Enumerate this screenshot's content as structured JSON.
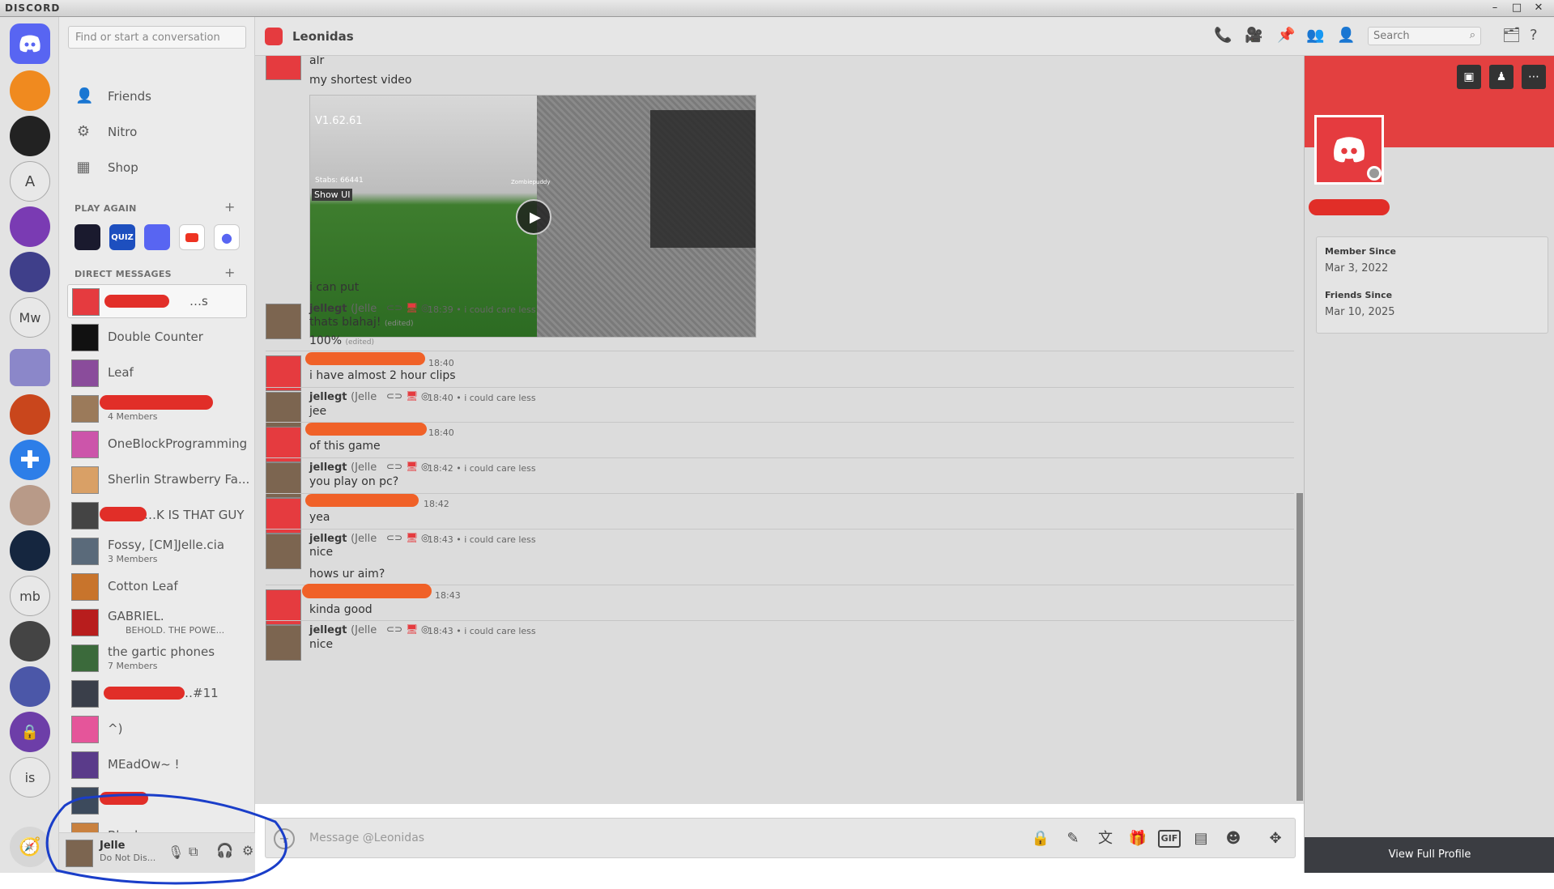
{
  "window": {
    "app_name": "DISCORD",
    "minimize": "–",
    "maximize": "□",
    "close": "✕"
  },
  "sidebar": {
    "search_placeholder": "Find or start a conversation",
    "nav": [
      {
        "label": "Friends"
      },
      {
        "label": "Nitro"
      },
      {
        "label": "Shop"
      }
    ],
    "play_again": {
      "heading": "PLAY AGAIN",
      "plus": "+",
      "apps": [
        "know what i meme?",
        "QUIZ",
        "Discord",
        "YouTube",
        "Amogus"
      ]
    },
    "dm_heading": "DIRECT MESSAGES",
    "dm_plus": "+",
    "dms": [
      {
        "name": "…s",
        "sub": ""
      },
      {
        "name": "Double Counter",
        "sub": ""
      },
      {
        "name": "Leaf",
        "sub": ""
      },
      {
        "name": "",
        "sub": "4 Members"
      },
      {
        "name": "OneBlockProgramming",
        "sub": ""
      },
      {
        "name": "Sherlin Strawberry Fa...",
        "sub": ""
      },
      {
        "name": "…K IS THAT GUY",
        "sub": ""
      },
      {
        "name": "Fossy, [CM]Jelle.cia",
        "sub": "3 Members"
      },
      {
        "name": "Cotton Leaf",
        "sub": ""
      },
      {
        "name": "GABRIEL.",
        "sub": "BEHOLD. THE POWE..."
      },
      {
        "name": "the gartic phones",
        "sub": "7 Members"
      },
      {
        "name": "…#11",
        "sub": ""
      },
      {
        "name": "^)",
        "sub": ""
      },
      {
        "name": "MEadOw~ !",
        "sub": ""
      },
      {
        "name": "",
        "sub": ""
      },
      {
        "name": "Blank",
        "sub": ""
      }
    ]
  },
  "user_panel": {
    "name": "Jelle",
    "status": "Do Not Dis..."
  },
  "topbar": {
    "channel": "Leonidas",
    "search_placeholder": "Search"
  },
  "messages": {
    "m_alr": "alr",
    "m_shortest": "my shortest video",
    "video": {
      "version": "V1.62.61",
      "show_ui": "Show UI",
      "stabs": "Stabs: 66441",
      "player": "Zombiepuddy"
    },
    "m_icanput": "i can put",
    "groups": [
      {
        "user": "jellegt",
        "nick": "(Jelle",
        "time": "18:39",
        "status": "i could care less",
        "lines": [
          "thats blahaj!",
          "100%"
        ],
        "edited": "(edited)"
      },
      {
        "user": "",
        "time": "18:40",
        "lines": [
          "i have almost 2 hour clips"
        ]
      },
      {
        "user": "jellegt",
        "nick": "(Jelle",
        "time": "18:40",
        "status": "i could care less",
        "lines": [
          "jee"
        ]
      },
      {
        "user": "",
        "time": "18:40",
        "lines": [
          "of this game"
        ]
      },
      {
        "user": "jellegt",
        "nick": "(Jelle",
        "time": "18:42",
        "status": "i could care less",
        "lines": [
          "you play on pc?"
        ]
      },
      {
        "user": "",
        "time": "18:42",
        "lines": [
          "yea"
        ]
      },
      {
        "user": "jellegt",
        "nick": "(Jelle",
        "time": "18:43",
        "status": "i could care less",
        "lines": [
          "nice",
          "hows ur aim?"
        ]
      },
      {
        "user": "",
        "time": "18:43",
        "lines": [
          "kinda good"
        ]
      },
      {
        "user": "jellegt",
        "nick": "(Jelle",
        "time": "18:43",
        "status": "i could care less",
        "lines": [
          "nice"
        ]
      }
    ]
  },
  "composer": {
    "placeholder": "Message @Leonidas",
    "gif": "GIF"
  },
  "profile": {
    "member_since_label": "Member Since",
    "member_since": "Mar 3, 2022",
    "friends_since_label": "Friends Since",
    "friends_since": "Mar 10, 2025",
    "view_full_profile": "View Full Profile"
  },
  "rail": [
    "A",
    "Mw",
    "mb",
    "is"
  ],
  "colors": {
    "discord_red": "#e53b3f",
    "banner_red": "#e34040",
    "annotation_blue": "#1a3ec9"
  }
}
